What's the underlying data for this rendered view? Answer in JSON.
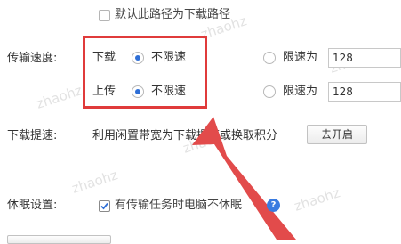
{
  "default_path_checkbox": {
    "label": "默认此路径为下载路径",
    "checked": false
  },
  "transfer_speed": {
    "label": "传输速度:",
    "download": {
      "label": "下载",
      "unlimited_label": "不限速",
      "limit_label": "限速为",
      "limit_value": "128",
      "selected": "unlimited"
    },
    "upload": {
      "label": "上传",
      "unlimited_label": "不限速",
      "limit_label": "限速为",
      "limit_value": "128",
      "selected": "unlimited"
    }
  },
  "download_boost": {
    "label": "下载提速:",
    "description": "利用闲置带宽为下载提速或换取积分",
    "button_label": "去开启"
  },
  "sleep_settings": {
    "label": "休眠设置:",
    "checkbox_label": "有传输任务时电脑不休眠",
    "checked": true,
    "help_icon": "question-icon"
  },
  "watermarks": [
    "zhaohz",
    "zhaohz",
    "zhaohz",
    "zhaohz",
    "zhaohz",
    "zhaohz"
  ],
  "colors": {
    "highlight": "#e03b3b",
    "arrow": "#e24b4b",
    "radio_selected": "#2f6fd6",
    "help_icon": "#3a7be0"
  }
}
